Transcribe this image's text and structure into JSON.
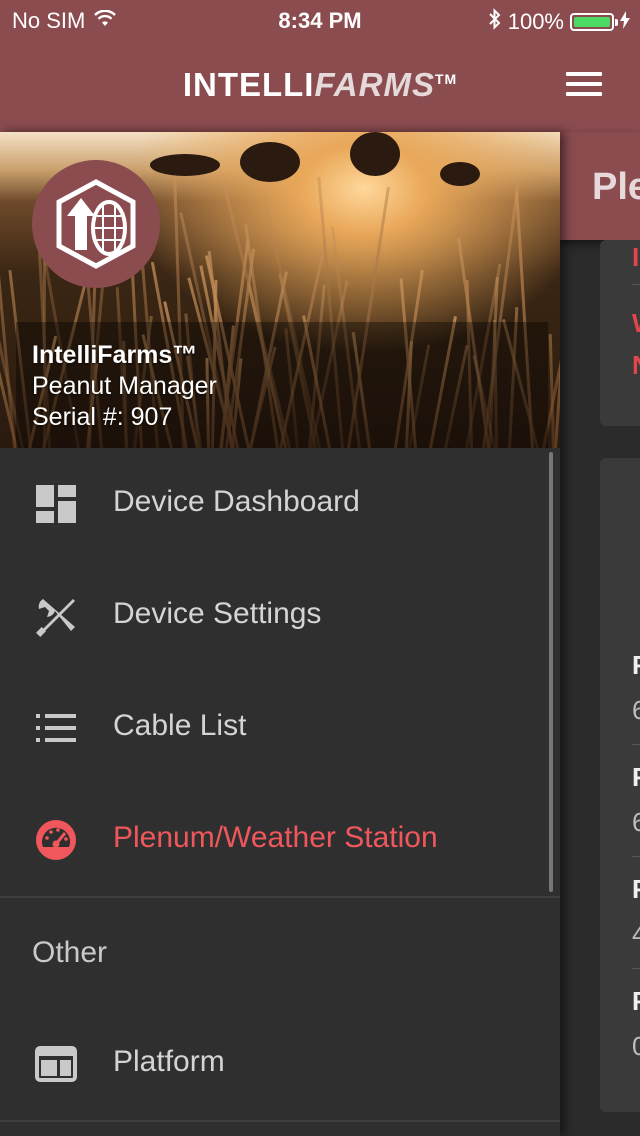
{
  "status_bar": {
    "carrier": "No SIM",
    "time": "8:34 PM",
    "battery_percent": "100%",
    "battery_level": 1.0,
    "battery_color": "#4cd964"
  },
  "header": {
    "brand_part1": "INTELLI",
    "brand_part2": "FARMS",
    "brand_tm": "TM",
    "menu_icon": "hamburger-menu-icon",
    "background_color": "#8b4c50"
  },
  "drawer": {
    "device_brand": "IntelliFarms™",
    "device_name": "Peanut Manager",
    "serial": "Serial #: 907",
    "items": [
      {
        "label": "Device Dashboard",
        "icon": "dashboard-icon",
        "active": false
      },
      {
        "label": "Device Settings",
        "icon": "tools-icon",
        "active": false
      },
      {
        "label": "Cable List",
        "icon": "list-icon",
        "active": false
      },
      {
        "label": "Plenum/Weather Station",
        "icon": "gauge-icon",
        "active": true
      }
    ],
    "other_section": "Other",
    "other_items": [
      {
        "label": "Platform",
        "icon": "platform-icon",
        "active": false
      }
    ],
    "active_color": "#f0575c"
  },
  "main": {
    "title_partial": "Ple",
    "card1_partial": [
      "I",
      "W",
      "N"
    ],
    "card2_rows": [
      {
        "label": "F",
        "value": "6"
      },
      {
        "label": "F",
        "value": "6"
      },
      {
        "label": "F",
        "value": "4"
      },
      {
        "label": "F",
        "value": "0"
      }
    ]
  }
}
